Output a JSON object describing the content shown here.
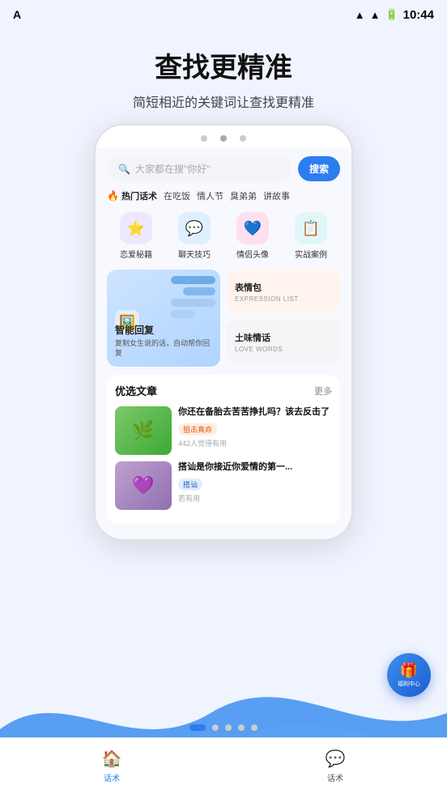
{
  "statusBar": {
    "left": "A",
    "time": "10:44",
    "batteryIcon": "🔋"
  },
  "header": {
    "title": "查找更精准",
    "subtitle": "简短相近的关键词让查找更精准"
  },
  "phone": {
    "searchPlaceholder": "大家都在搜\"你好\"",
    "searchBtn": "搜索",
    "hotLabel": "热门话术",
    "hotTags": [
      "在吃饭",
      "情人节",
      "臭弟弟",
      "讲故事"
    ],
    "categories": [
      {
        "label": "恋爱秘籍",
        "emoji": "⭐",
        "color": "purple"
      },
      {
        "label": "聊天技巧",
        "emoji": "💬",
        "color": "blue"
      },
      {
        "label": "情侣头像",
        "emoji": "💙",
        "color": "pink"
      },
      {
        "label": "实战案例",
        "emoji": "📋",
        "color": "teal"
      }
    ],
    "mainCard": {
      "title": "智能回复",
      "desc": "复制女生说的话，自动帮你回复"
    },
    "sideCards": [
      {
        "title": "表情包",
        "sub": "EXPRESSION LIST",
        "bg": "warm"
      },
      {
        "title": "土味情话",
        "sub": "LOVE WORDS",
        "bg": "blue"
      }
    ],
    "articlesTitle": "优选文章",
    "articlesMore": "更多",
    "articles": [
      {
        "thumb": "green",
        "title": "你还在备胎去苦苦挣扎吗？该去反击了",
        "tag": "狙击真命",
        "tagColor": "orange",
        "stats": "442人觉得有用"
      },
      {
        "thumb": "purple",
        "title": "搭讪是你接近你爱情的第一...",
        "tag": "搭讪",
        "tagColor": "blue",
        "stats": "若有用"
      }
    ],
    "giftLabel": "福利中心",
    "navItems": [
      {
        "icon": "🏠",
        "label": "话术",
        "active": true
      },
      {
        "icon": "💬",
        "label": "话术",
        "active": false
      }
    ]
  },
  "pageDots": [
    true,
    false,
    false,
    false,
    false
  ]
}
